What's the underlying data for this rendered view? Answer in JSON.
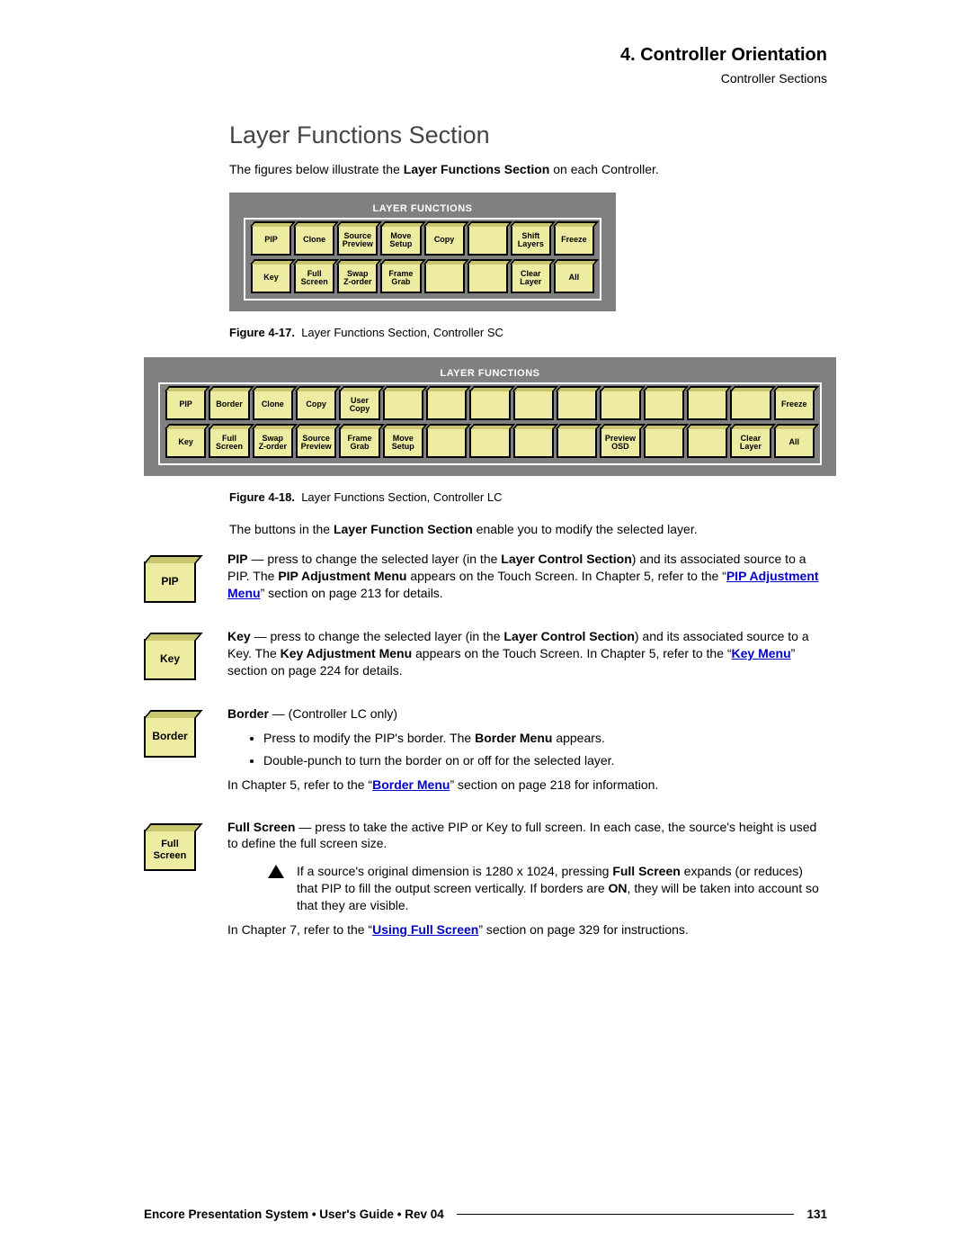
{
  "header": {
    "chapter": "4.  Controller Orientation",
    "section": "Controller Sections"
  },
  "title": "Layer Functions Section",
  "intro_prefix": "The figures below illustrate the ",
  "intro_bold": "Layer Functions Section",
  "intro_suffix": " on each Controller.",
  "panel_sc": {
    "title": "LAYER FUNCTIONS",
    "row1": [
      "PIP",
      "Clone",
      "Source\nPreview",
      "Move\nSetup",
      "Copy",
      "",
      "Shift\nLayers",
      "Freeze"
    ],
    "row2": [
      "Key",
      "Full\nScreen",
      "Swap\nZ-order",
      "Frame\nGrab",
      "",
      "",
      "Clear\nLayer",
      "All"
    ]
  },
  "fig17_label": "Figure 4-17.",
  "fig17_text": "Layer Functions Section, Controller SC",
  "panel_lc": {
    "title": "LAYER FUNCTIONS",
    "row1": [
      "PIP",
      "Border",
      "Clone",
      "Copy",
      "User\nCopy",
      "",
      "",
      "",
      "",
      "",
      "",
      "",
      "",
      "",
      "Freeze"
    ],
    "row2": [
      "Key",
      "Full\nScreen",
      "Swap\nZ-order",
      "Source\nPreview",
      "Frame\nGrab",
      "Move\nSetup",
      "",
      "",
      "",
      "",
      "Preview\nOSD",
      "",
      "",
      "Clear\nLayer",
      "All"
    ]
  },
  "fig18_label": "Figure 4-18.",
  "fig18_text": "Layer Functions Section, Controller LC",
  "enable_prefix": "The buttons in the ",
  "enable_bold": "Layer Function Section",
  "enable_suffix": " enable you to modify the selected layer.",
  "desc": {
    "pip": {
      "key_label": "PIP",
      "lead_bold": "PIP",
      "text1a": " — press to change the selected layer (in the ",
      "text1b": "Layer Control Section",
      "text1c": ") and its associated source to a PIP.  The ",
      "text1d": "PIP Adjustment Menu",
      "text1e": " appears on the Touch Screen.  In Chapter 5, refer to the “",
      "link": "PIP Adjustment Menu",
      "text1f": "” section on page 213 for details."
    },
    "key": {
      "key_label": "Key",
      "lead_bold": "Key",
      "text1a": " — press to change the selected layer (in the ",
      "text1b": "Layer Control Section",
      "text1c": ") and its associated source to a Key.  The ",
      "text1d": "Key Adjustment Menu",
      "text1e": " appears on the Touch Screen.  In Chapter 5, refer to the “",
      "link": "Key Menu",
      "text1f": "” section on page 224 for details."
    },
    "border": {
      "key_label": "Border",
      "lead_bold": "Border",
      "text_head": " — (Controller LC only)",
      "bullet1a": "Press to modify the PIP's border.  The ",
      "bullet1b": "Border Menu",
      "bullet1c": " appears.",
      "bullet2": "Double-punch to turn the border on or off for the selected layer.",
      "after_a": "In Chapter 5, refer to the “",
      "after_link": "Border Menu",
      "after_b": "” section on page 218 for information."
    },
    "fullscreen": {
      "key_label": "Full\nScreen",
      "lead_bold": "Full Screen",
      "text_head": " — press to take the active PIP or Key to full screen.  In each case, the source's height is used to define the full screen size.",
      "tri_a": "If a source's original dimension is 1280 x 1024, pressing ",
      "tri_bold": "Full Screen",
      "tri_b": " expands (or reduces) that PIP to fill the output screen vertically.  If borders are ",
      "tri_on": "ON",
      "tri_c": ", they will be taken into account so that they are visible.",
      "after_a": "In Chapter 7, refer to the “",
      "after_link": "Using Full Screen",
      "after_b": "” section on page 329 for instructions."
    }
  },
  "footer": {
    "left": "Encore Presentation System  •  User's Guide  •  Rev 04",
    "page": "131"
  }
}
